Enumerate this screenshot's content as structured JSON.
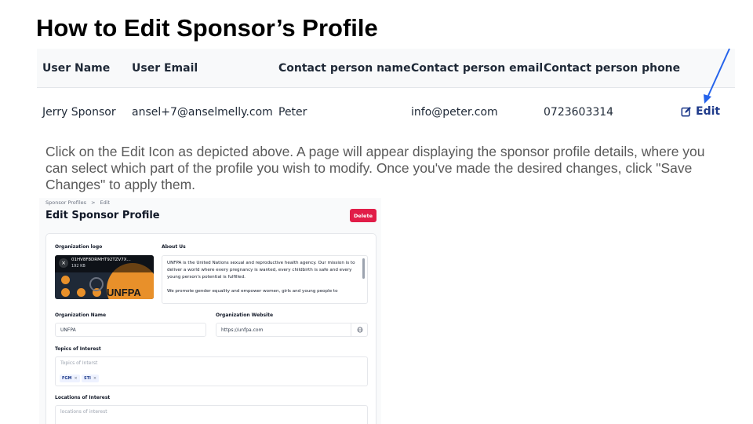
{
  "slide": {
    "title": "How to Edit Sponsor’s Profile",
    "instructions": "Click on the Edit Icon as depicted above. A page will appear displaying the sponsor profile details, where you can select which part of the profile you wish to modify. Once you've made the desired changes, click \"Save Changes\" to apply them."
  },
  "table": {
    "headers": [
      "User Name",
      "User Email",
      "Contact person name",
      "Contact person email",
      "Contact person phone"
    ],
    "row": [
      "Jerry Sponsor",
      "ansel+7@anselmelly.com",
      "Peter",
      "info@peter.com",
      "0723603314"
    ],
    "edit_label": "Edit"
  },
  "colors": {
    "arrow": "#2563eb",
    "edit_link": "#1e3a8a",
    "delete_button": "#e11d48"
  },
  "app": {
    "breadcrumb": {
      "parent": "Sponsor Profiles",
      "separator": ">",
      "current": "Edit"
    },
    "title": "Edit Sponsor Profile",
    "delete_label": "Delete",
    "logo_label": "Organization logo",
    "logo_file_name": "01HV8F8DRMHT92TZV7X...",
    "logo_file_size": "192 KB",
    "logo_text": "UNFPA",
    "about_label": "About Us",
    "about_p1": "UNFPA is the United Nations sexual and reproductive health agency. Our mission is to deliver a world where every pregnancy is wanted, every childbirth is safe and every young person's potential is fulfilled.",
    "about_p2": "We promote gender equality and empower women, girls and young people to",
    "org_name_label": "Organization Name",
    "org_name_value": "UNFPA",
    "org_website_label": "Organization Website",
    "org_website_value": "https://unfpa.com",
    "topics_label": "Topics of Interest",
    "topics_placeholder": "Topics of Interst",
    "topics": [
      "FGM",
      "STI"
    ],
    "chip_remove": "×",
    "locations_label": "Locations of Interest",
    "locations_placeholder": "locations of interest",
    "remove_logo_symbol": "×"
  }
}
